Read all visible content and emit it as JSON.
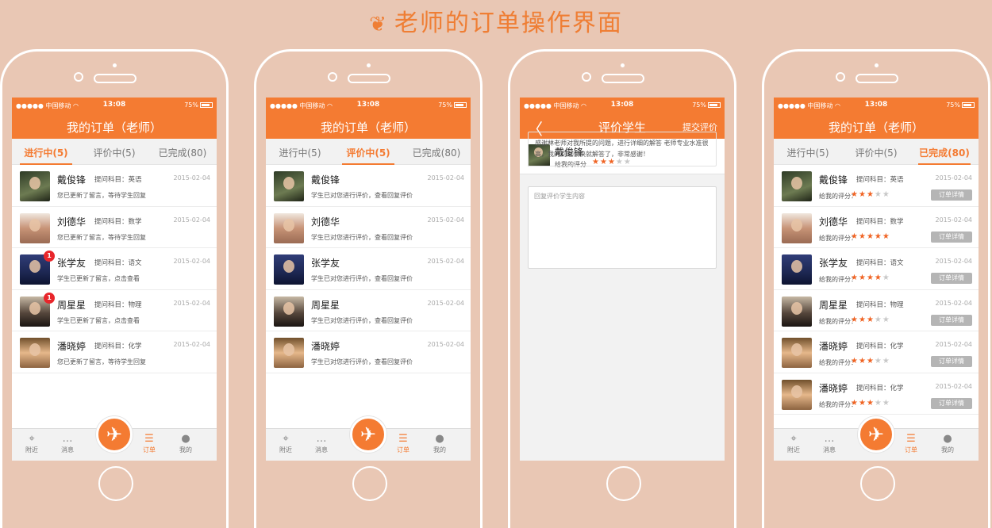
{
  "header": {
    "title": "老师的订单操作界面",
    "leaf_icon": "leaf-icon"
  },
  "status": {
    "carrier": "●●●●● 中国移动 ◠",
    "time": "13:08",
    "battery": "75%"
  },
  "phones": [
    {
      "nav_title": "我的订单（老师）",
      "tabs": [
        "进行中(5)",
        "评价中(5)",
        "已完成(80)"
      ],
      "active": 0,
      "rows": [
        {
          "name": "戴俊锋",
          "subject": "提问科目：英语",
          "date": "2015-02-04",
          "msg": "您已更新了留言，等待学生回复",
          "badge": ""
        },
        {
          "name": "刘德华",
          "subject": "提问科目：数学",
          "date": "2015-02-04",
          "msg": "您已更新了留言，等待学生回复",
          "badge": ""
        },
        {
          "name": "张学友",
          "subject": "提问科目：语文",
          "date": "2015-02-04",
          "msg": "学生已更新了留言，点击查看",
          "badge": "1"
        },
        {
          "name": "周星星",
          "subject": "提问科目：物理",
          "date": "2015-02-04",
          "msg": "学生已更新了留言，点击查看",
          "badge": "1"
        },
        {
          "name": "潘晓婷",
          "subject": "提问科目：化学",
          "date": "2015-02-04",
          "msg": "您已更新了留言，等待学生回复",
          "badge": ""
        }
      ]
    },
    {
      "nav_title": "我的订单（老师）",
      "tabs": [
        "进行中(5)",
        "评价中(5)",
        "已完成(80)"
      ],
      "active": 1,
      "rows": [
        {
          "name": "戴俊锋",
          "date": "2015-02-04",
          "msg": "学生已对您进行评价，查看回复评价"
        },
        {
          "name": "刘德华",
          "date": "2015-02-04",
          "msg": "学生已对您进行评价，查看回复评价"
        },
        {
          "name": "张学友",
          "date": "2015-02-04",
          "msg": "学生已对您进行评价，查看回复评价"
        },
        {
          "name": "周星星",
          "date": "2015-02-04",
          "msg": "学生已对您进行评价，查看回复评价"
        },
        {
          "name": "潘晓婷",
          "date": "2015-02-04",
          "msg": "学生已对您进行评价，查看回复评价"
        }
      ]
    },
    {
      "nav_title": "评价学生",
      "back": "〈",
      "action": "提交评价",
      "student": {
        "name": "戴俊锋",
        "label": "给我的评分",
        "stars": 3
      },
      "review": "感谢林老师对我所提的问题，进行详细的解答 老师专业水准很高，我的问题很快就解答了，非常感谢！",
      "placeholder": "回复评价学生内容"
    },
    {
      "nav_title": "我的订单（老师）",
      "tabs": [
        "进行中(5)",
        "评价中(5)",
        "已完成(80)"
      ],
      "active": 2,
      "rows": [
        {
          "name": "戴俊锋",
          "subject": "提问科目：英语",
          "date": "2015-02-04",
          "label": "给我的评分：",
          "stars": 3,
          "btn": "订单详情"
        },
        {
          "name": "刘德华",
          "subject": "提问科目：数学",
          "date": "2015-02-04",
          "label": "给我的评分：",
          "stars": 5,
          "btn": "订单详情"
        },
        {
          "name": "张学友",
          "subject": "提问科目：语文",
          "date": "2015-02-04",
          "label": "给我的评分：",
          "stars": 4,
          "btn": "订单详情"
        },
        {
          "name": "周星星",
          "subject": "提问科目：物理",
          "date": "2015-02-04",
          "label": "给我的评分：",
          "stars": 3,
          "btn": "订单详情"
        },
        {
          "name": "潘晓婷",
          "subject": "提问科目：化学",
          "date": "2015-02-04",
          "label": "给我的评分：",
          "stars": 3,
          "btn": "订单详情"
        },
        {
          "name": "潘晓婷",
          "subject": "提问科目：化学",
          "date": "2015-02-04",
          "label": "给我的评分：",
          "stars": 3,
          "btn": "订单详情"
        }
      ]
    }
  ],
  "tabbar": {
    "items": [
      "附近",
      "消息",
      "订单",
      "我的"
    ],
    "active": 2,
    "icons": [
      "location-icon",
      "chat-icon",
      "order-icon",
      "user-icon"
    ]
  },
  "colors": {
    "accent": "#f47b32",
    "background": "#e9c7b4",
    "star": "#f06424"
  }
}
